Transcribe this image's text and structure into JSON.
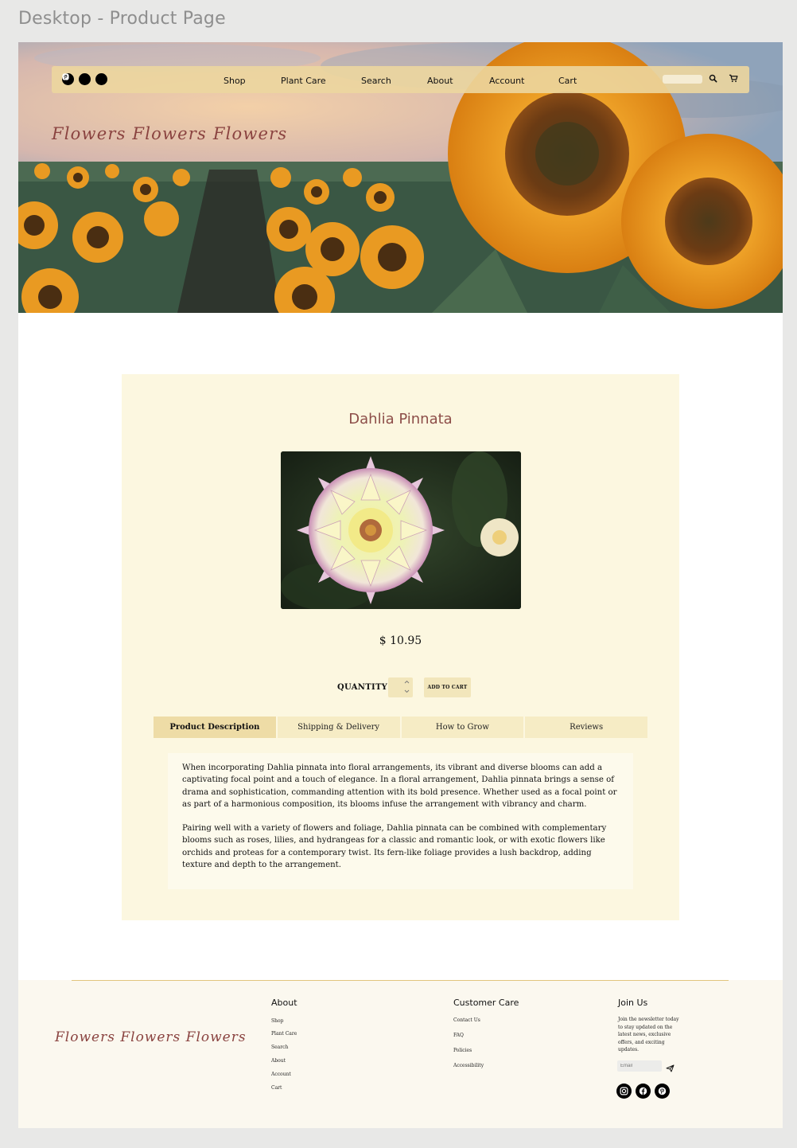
{
  "frame_title": "Desktop - Product Page",
  "header": {
    "social_icons": [
      "instagram-icon",
      "facebook-icon",
      "pinterest-icon"
    ],
    "nav": [
      "Shop",
      "Plant Care",
      "Search",
      "About",
      "Account",
      "Cart"
    ],
    "search_placeholder": "",
    "hero_script": "Flowers Flowers Flowers"
  },
  "product": {
    "title": "Dahlia Pinnata",
    "price": "$ 10.95",
    "quantity_label": "QUANTITY",
    "add_to_cart": "ADD TO CART",
    "tabs": [
      "Product Description",
      "Shipping & Delivery",
      "How to Grow",
      "Reviews"
    ],
    "active_tab": "Product Description",
    "description": [
      "When incorporating Dahlia pinnata into floral arrangements, its vibrant and diverse blooms can add a captivating focal point and a touch of elegance. In a floral arrangement, Dahlia pinnata brings a sense of drama and sophistication, commanding attention with its bold presence. Whether used as a focal point or as part of a harmonious composition, its blooms infuse the arrangement with vibrancy and charm.",
      "Pairing well with a variety of flowers and foliage, Dahlia pinnata can be combined with complementary blooms such as roses, lilies, and hydrangeas for a classic and romantic look, or with exotic flowers like orchids and proteas for a contemporary twist. Its fern-like foliage provides a lush backdrop, adding texture and depth to the arrangement."
    ]
  },
  "footer": {
    "script": "Flowers Flowers Flowers",
    "about": {
      "heading": "About",
      "links": [
        "Shop",
        "Plant Care",
        "Search",
        "About",
        "Account",
        "Cart"
      ]
    },
    "customer_care": {
      "heading": "Customer Care",
      "links": [
        "Contact Us",
        "FAQ",
        "Policies",
        "Accessibility"
      ]
    },
    "join": {
      "heading": "Join Us",
      "text": "Join the newsletter today to stay updated on the latest news, exclusive offers, and exciting updates.",
      "email_placeholder": "Email"
    },
    "social_icons": [
      "instagram-icon",
      "facebook-icon",
      "pinterest-icon"
    ]
  },
  "colors": {
    "page_bg": "#e8e8e7",
    "navbar": "#ecd69e",
    "card_bg": "#fcf7e0",
    "title_accent": "#8d4e49",
    "script_accent": "#8a4340",
    "button_bg": "#f2e6bb",
    "footer_line": "#e2c57e"
  }
}
